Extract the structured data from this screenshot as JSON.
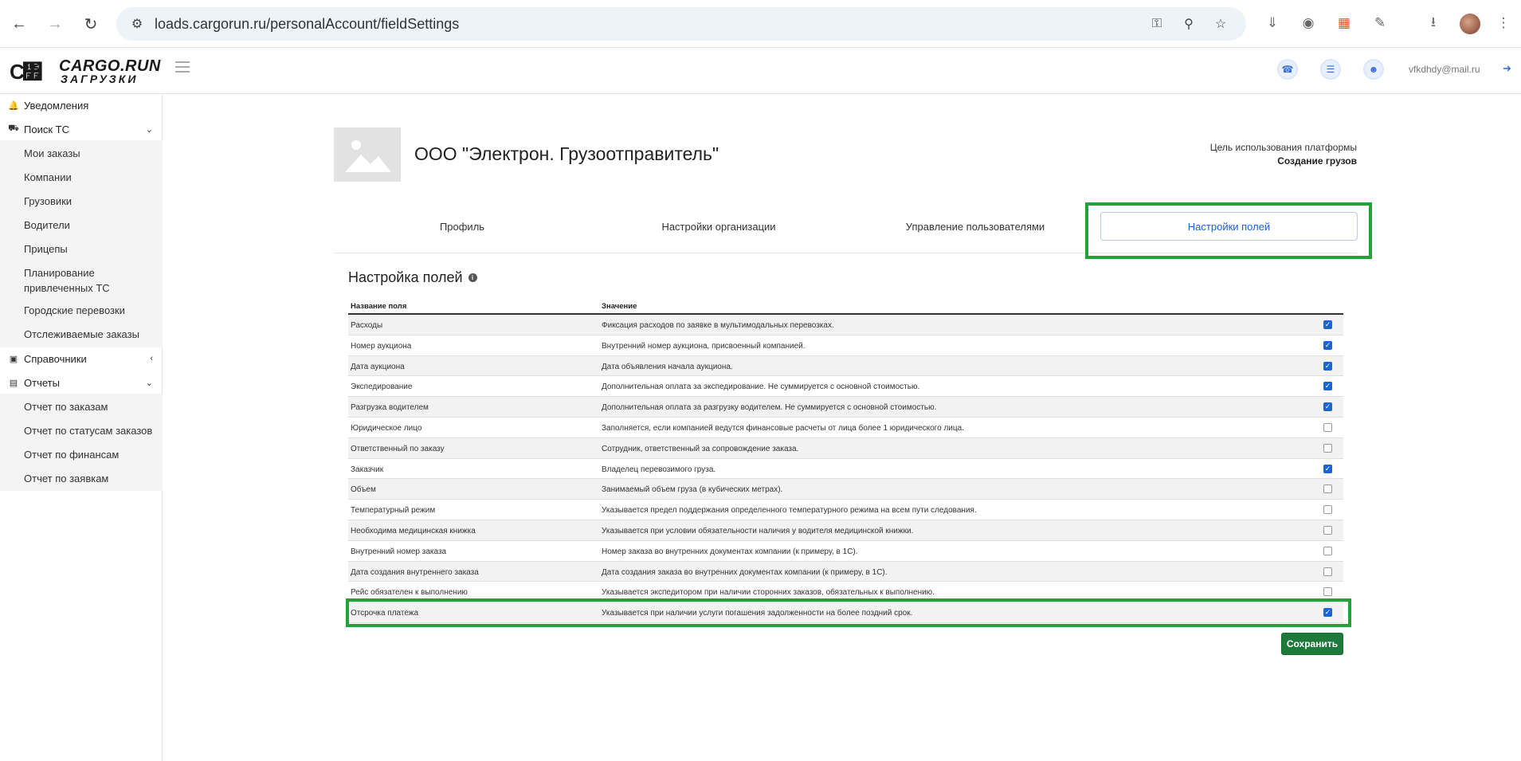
{
  "browser": {
    "url": "loads.cargorun.ru/personalAccount/fieldSettings"
  },
  "header": {
    "logo_main": "CARGO.RUN",
    "logo_sub": "ЗАГРУЗКИ",
    "user_email": "vfkdhdy@mail.ru"
  },
  "sidebar": {
    "notifications": "Уведомления",
    "search_ts": "Поиск ТС",
    "search_sub": [
      "Мои заказы",
      "Компании",
      "Грузовики",
      "Водители",
      "Прицепы",
      "Планирование привлеченных ТС",
      "Городские перевозки",
      "Отслеживаемые заказы"
    ],
    "directories": "Справочники",
    "reports": "Отчеты",
    "reports_sub": [
      "Отчет по заказам",
      "Отчет по статусам заказов",
      "Отчет по финансам",
      "Отчет по заявкам"
    ]
  },
  "company": {
    "title": "ООО \"Электрон. Грузоотправитель\"",
    "purpose_label": "Цель использования платформы",
    "purpose_value": "Создание грузов"
  },
  "tabs": [
    "Профиль",
    "Настройки организации",
    "Управление пользователями",
    "Настройки полей"
  ],
  "section_title": "Настройка полей",
  "table": {
    "col_name": "Название поля",
    "col_value": "Значение",
    "rows": [
      {
        "name": "Расходы",
        "desc": "Фиксация расходов по заявке в мультимодальных перевозках.",
        "checked": true
      },
      {
        "name": "Номер аукциона",
        "desc": "Внутренний номер аукциона, присвоенный компанией.",
        "checked": true
      },
      {
        "name": "Дата аукциона",
        "desc": "Дата объявления начала аукциона.",
        "checked": true
      },
      {
        "name": "Экспедирование",
        "desc": "Дополнительная оплата за экспедирование. Не суммируется с основной стоимостью.",
        "checked": true
      },
      {
        "name": "Разгрузка водителем",
        "desc": "Дополнительная оплата за разгрузку водителем. Не суммируется с основной стоимостью.",
        "checked": true
      },
      {
        "name": "Юридическое лицо",
        "desc": "Заполняется, если компанией ведутся финансовые расчеты от лица более 1 юридического лица.",
        "checked": false
      },
      {
        "name": "Ответственный по заказу",
        "desc": "Сотрудник, ответственный за сопровождение заказа.",
        "checked": false
      },
      {
        "name": "Заказчик",
        "desc": "Владелец перевозимого груза.",
        "checked": true
      },
      {
        "name": "Объем",
        "desc": "Занимаемый объем груза (в кубических метрах).",
        "checked": false
      },
      {
        "name": "Температурный режим",
        "desc": "Указывается предел поддержания определенного температурного режима на всем пути следования.",
        "checked": false
      },
      {
        "name": "Необходима медицинская книжка",
        "desc": "Указывается при условии обязательности наличия у водителя медицинской книжки.",
        "checked": false
      },
      {
        "name": "Внутренний номер заказа",
        "desc": "Номер заказа во внутренних документах компании (к примеру, в 1С).",
        "checked": false
      },
      {
        "name": "Дата создания внутреннего заказа",
        "desc": "Дата создания заказа во внутренних документах компании (к примеру, в 1С).",
        "checked": false
      },
      {
        "name": "Рейс обязателен к выполнению",
        "desc": "Указывается экспедитором при наличии сторонних заказов, обязательных к выполнению.",
        "checked": false
      },
      {
        "name": "Отсрочка платежа",
        "desc": "Указывается при наличии услуги погашения задолженности на более поздний срок.",
        "checked": true
      }
    ]
  },
  "save_label": "Сохранить",
  "colors": {
    "highlight": "#22a33a",
    "accent": "#1a64d6",
    "save": "#1e7a3a"
  }
}
